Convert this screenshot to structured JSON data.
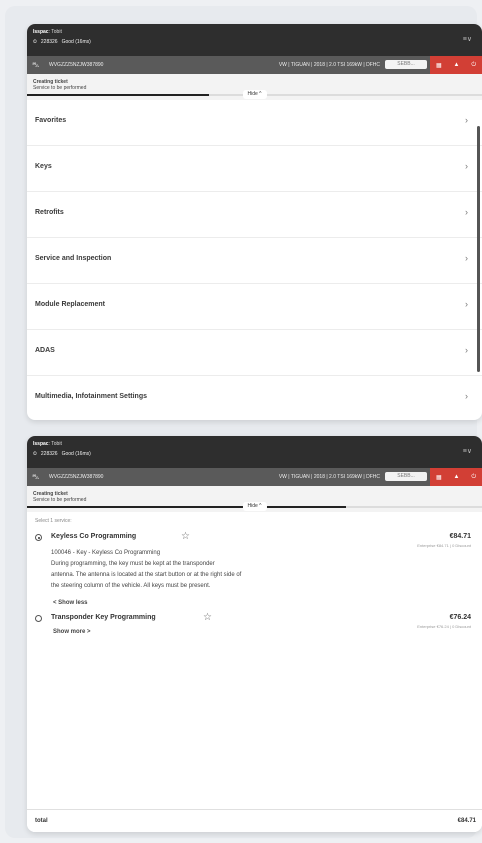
{
  "header": {
    "user_label": "Isspac",
    "user_value": "Tobit",
    "id": "228326",
    "status": "Good (16ms)",
    "menu": "≡∨"
  },
  "vehicle": {
    "vin": "WVGZZZ5NZJW387890",
    "spec": "VW | TIGUAN | 2018 | 2.0 TSI 169kW | DFHC",
    "search_placeholder": "SEBB..."
  },
  "ticket": {
    "title": "Creating ticket",
    "subtitle": "Service to be performed",
    "hide": "Hide",
    "progress_panel1": 0.4,
    "progress_panel2": 0.7
  },
  "categories": [
    {
      "label": "Favorites"
    },
    {
      "label": "Keys"
    },
    {
      "label": "Retrofits"
    },
    {
      "label": "Service and Inspection"
    },
    {
      "label": "Module Replacement"
    },
    {
      "label": "ADAS"
    },
    {
      "label": "Multimedia, Infotainment Settings"
    }
  ],
  "services": {
    "select_label": "Select 1 service:",
    "items": [
      {
        "name": "Keyless Co Programming",
        "price": "€84.71",
        "sub": "Enterprise €84.71 | 0 Discount",
        "desc1": "100046 - Key - Keyless Co Programming",
        "desc2": "During programming, the key must be kept at the transponder",
        "desc3": "antenna. The antenna is located at the start button or at the right side of",
        "desc4": "the steering column of the vehicle. All keys must be present.",
        "toggle": "< Show less",
        "selected": true
      },
      {
        "name": "Transponder Key Programming",
        "price": "€76.24",
        "sub": "Enterprise €76.24 | 0 Discount",
        "toggle": "Show more >",
        "selected": false
      }
    ]
  },
  "footer": {
    "total_label": "total",
    "total_value": "€84.71"
  }
}
